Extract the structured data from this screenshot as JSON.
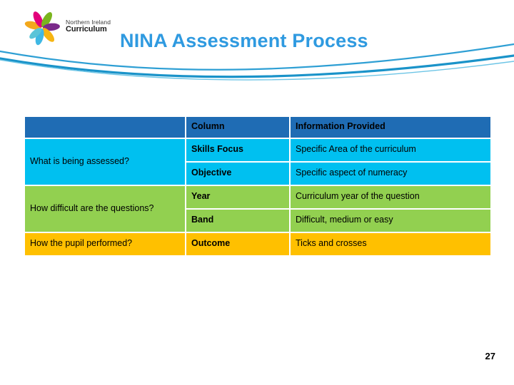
{
  "header": {
    "title": "NINA Assessment Process",
    "title_color": "#2f9ae0",
    "logo": {
      "icon": "ni-curriculum-pinwheel-logo",
      "line1": "Northern Ireland",
      "line2": "Curriculum"
    },
    "decoration": "blue-wave-lines"
  },
  "table": {
    "columns": [
      {
        "key": "question",
        "header": ""
      },
      {
        "key": "column",
        "header": "Column"
      },
      {
        "key": "info",
        "header": "Information Provided"
      }
    ],
    "groups": [
      {
        "question": "What is being assessed?",
        "color": "#00c0f0",
        "rows": [
          {
            "column": "Skills Focus",
            "info": "Specific Area of the curriculum"
          },
          {
            "column": "Objective",
            "info": "Specific aspect of numeracy"
          }
        ]
      },
      {
        "question": "How difficult are the questions?",
        "color": "#92d050",
        "rows": [
          {
            "column": "Year",
            "info": "Curriculum year of the question"
          },
          {
            "column": "Band",
            "info": "Difficult, medium or easy"
          }
        ]
      },
      {
        "question": "How the pupil performed?",
        "color": "#ffc000",
        "rows": [
          {
            "column": "Outcome",
            "info": "Ticks and crosses"
          }
        ]
      }
    ],
    "header_color": "#1f6cb4"
  },
  "footer": {
    "page_number": "27"
  }
}
